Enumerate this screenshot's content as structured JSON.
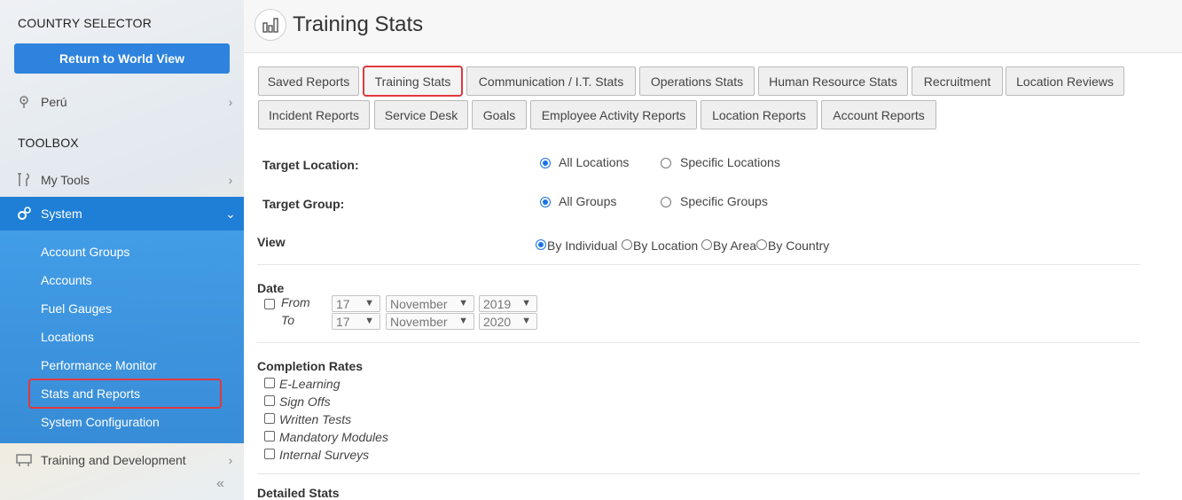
{
  "sidebar": {
    "country_selector_title": "COUNTRY SELECTOR",
    "world_view_button": "Return to World View",
    "country": "Perú",
    "toolbox_title": "TOOLBOX",
    "my_tools": "My Tools",
    "system": "System",
    "system_items": [
      "Account Groups",
      "Accounts",
      "Fuel Gauges",
      "Locations",
      "Performance Monitor",
      "Stats and Reports",
      "System Configuration"
    ],
    "training": "Training and Development",
    "collapse_glyph": "«"
  },
  "header": {
    "title": "Training Stats"
  },
  "tabs_row1": [
    "Saved Reports",
    "Training Stats",
    "Communication / I.T. Stats",
    "Operations Stats",
    "Human Resource Stats",
    "Recruitment",
    "Location Reviews"
  ],
  "tabs_row2": [
    "Incident Reports",
    "Service Desk",
    "Goals",
    "Employee Activity Reports",
    "Location Reports",
    "Account Reports"
  ],
  "form": {
    "target_location_label": "Target Location:",
    "target_location_options": [
      "All Locations",
      "Specific Locations"
    ],
    "target_group_label": "Target Group:",
    "target_group_options": [
      "All Groups",
      "Specific Groups"
    ],
    "view_label": "View",
    "view_options": [
      "By Individual",
      "By Location",
      "By Area",
      "By Country"
    ],
    "date_label": "Date",
    "from_label": "From",
    "to_label": "To",
    "from_day": "17",
    "from_month": "November",
    "from_year": "2019",
    "to_day": "17",
    "to_month": "November",
    "to_year": "2020",
    "completion_label": "Completion Rates",
    "completion_items": [
      "E-Learning",
      "Sign Offs",
      "Written Tests",
      "Mandatory Modules",
      "Internal Surveys"
    ],
    "detailed_label": "Detailed Stats"
  }
}
